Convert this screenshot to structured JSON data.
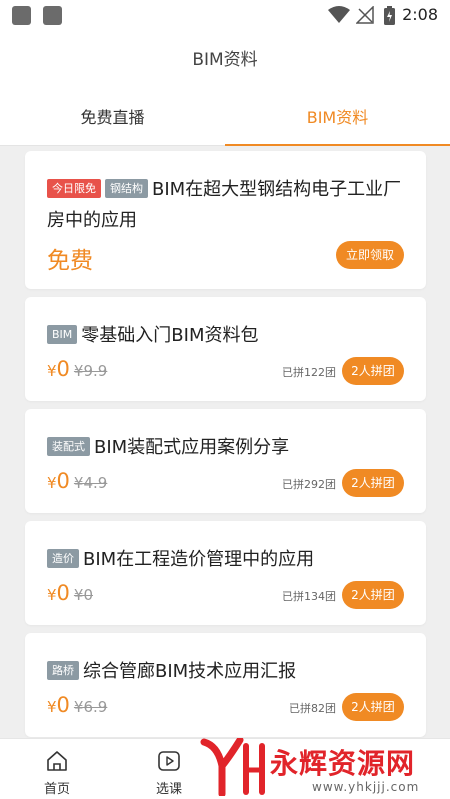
{
  "status_bar": {
    "time": "2:08"
  },
  "header": {
    "title": "BIM资料"
  },
  "tabs": [
    {
      "label": "免费直播",
      "active": false
    },
    {
      "label": "BIM资料",
      "active": true
    }
  ],
  "cards": [
    {
      "tags": [
        {
          "text": "今日限免",
          "color": "#e8524a"
        },
        {
          "text": "钢结构",
          "color": "#8c9aa3"
        }
      ],
      "title": "BIM在超大型钢结构电子工业厂房中的应用",
      "price_text": "免费",
      "button": "立即领取"
    },
    {
      "tags": [
        {
          "text": "BIM",
          "color": "#8c9aa3"
        }
      ],
      "title": "零基础入门BIM资料包",
      "currency": "¥",
      "price": "0",
      "original_price": "¥9.9",
      "grouped": "已拼122团",
      "button": "2人拼团"
    },
    {
      "tags": [
        {
          "text": "装配式",
          "color": "#8c9aa3"
        }
      ],
      "title": "BIM装配式应用案例分享",
      "currency": "¥",
      "price": "0",
      "original_price": "¥4.9",
      "grouped": "已拼292团",
      "button": "2人拼团"
    },
    {
      "tags": [
        {
          "text": "造价",
          "color": "#8c9aa3"
        }
      ],
      "title": "BIM在工程造价管理中的应用",
      "currency": "¥",
      "price": "0",
      "original_price": "¥0",
      "grouped": "已拼134团",
      "button": "2人拼团"
    },
    {
      "tags": [
        {
          "text": "路桥",
          "color": "#8c9aa3"
        }
      ],
      "title": "综合管廊BIM技术应用汇报",
      "currency": "¥",
      "price": "0",
      "original_price": "¥6.9",
      "grouped": "已拼82团",
      "button": "2人拼团"
    }
  ],
  "bottom_nav": [
    {
      "label": "首页",
      "icon": "home-icon"
    },
    {
      "label": "选课",
      "icon": "play-icon"
    }
  ],
  "watermark": {
    "text": "永辉资源网",
    "url": "www.yhkjjj.com"
  },
  "colors": {
    "accent": "#f08a24",
    "tag_red": "#e8524a",
    "tag_gray": "#8c9aa3"
  }
}
